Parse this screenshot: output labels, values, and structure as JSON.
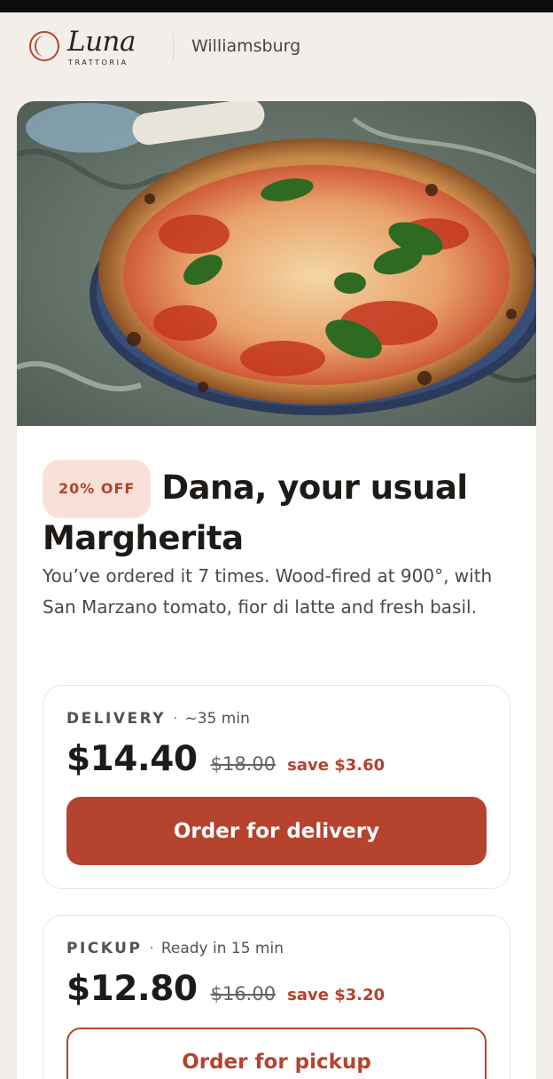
{
  "brand": {
    "name": "Luna",
    "subtitle": "TRATTORIA",
    "icon": "crescent-moon-icon",
    "accent_color": "#b5432e"
  },
  "header": {
    "location": "Williamsburg"
  },
  "offer": {
    "badge": "20% OFF",
    "title": "Dana, your usual Margherita",
    "description": "You’ve ordered it 7 times. Wood-fired at 900°, with San Marzano tomato, fior di latte and fresh basil."
  },
  "delivery": {
    "label": "DELIVERY",
    "time": "~35 min",
    "price": "$14.40",
    "old_price": "$18.00",
    "save": "save $3.60",
    "button": "Order for delivery"
  },
  "pickup": {
    "label": "PICKUP",
    "time": "Ready in 15 min",
    "price": "$12.80",
    "old_price": "$16.00",
    "save": "save $3.20",
    "button": "Order for pickup"
  }
}
